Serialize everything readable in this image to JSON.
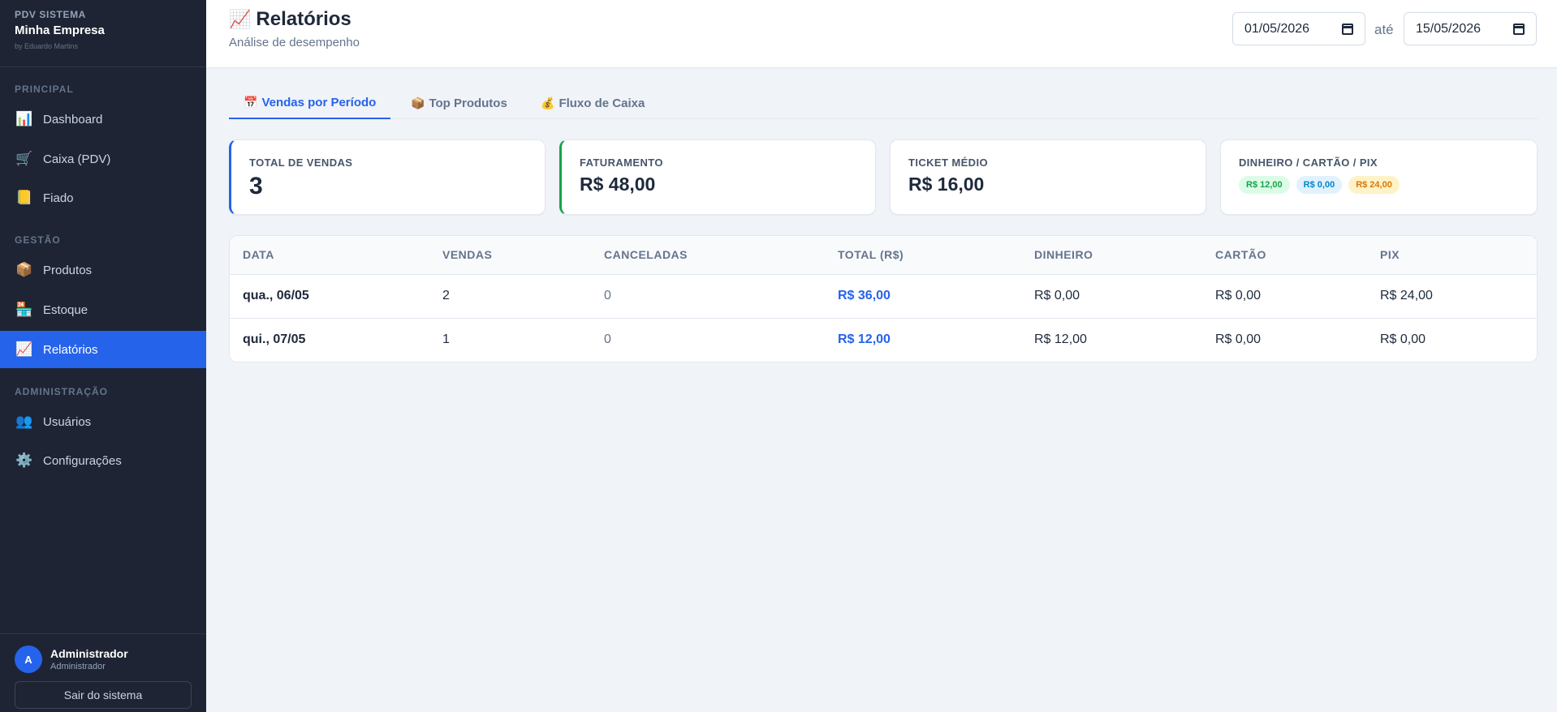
{
  "brand": {
    "kicker": "PDV SISTEMA",
    "name": "Minha Empresa",
    "by": "by Eduardo Martins"
  },
  "sidebar": {
    "sections": [
      {
        "label": "PRINCIPAL"
      },
      {
        "label": "GESTÃO"
      },
      {
        "label": "ADMINISTRAÇÃO"
      }
    ],
    "items": [
      {
        "label": "Dashboard",
        "icon": "bar-chart-icon",
        "glyph": "📊"
      },
      {
        "label": "Caixa (PDV)",
        "icon": "cart-icon",
        "glyph": "🛒"
      },
      {
        "label": "Fiado",
        "icon": "ledger-icon",
        "glyph": "📒"
      },
      {
        "label": "Produtos",
        "icon": "package-icon",
        "glyph": "📦"
      },
      {
        "label": "Estoque",
        "icon": "store-icon",
        "glyph": "🏪"
      },
      {
        "label": "Relatórios",
        "icon": "chart-up-icon",
        "glyph": "📈",
        "active": true
      },
      {
        "label": "Usuários",
        "icon": "users-icon",
        "glyph": "👥"
      },
      {
        "label": "Configurações",
        "icon": "gear-icon",
        "glyph": "⚙️"
      }
    ]
  },
  "user": {
    "initial": "A",
    "name": "Administrador",
    "role": "Administrador",
    "logout_label": "Sair do sistema"
  },
  "header": {
    "title_glyph": "📈",
    "title": "Relatórios",
    "subtitle": "Análise de desempenho",
    "date_from": "01/05/2026",
    "date_sep": "até",
    "date_to": "15/05/2026"
  },
  "tabs": [
    {
      "glyph": "📅",
      "label": "Vendas por Período",
      "active": true
    },
    {
      "glyph": "📦",
      "label": "Top Produtos"
    },
    {
      "glyph": "💰",
      "label": "Fluxo de Caixa"
    }
  ],
  "cards": {
    "total_vendas": {
      "label": "TOTAL DE VENDAS",
      "value": "3"
    },
    "faturamento": {
      "label": "FATURAMENTO",
      "value": "R$ 48,00"
    },
    "ticket": {
      "label": "TICKET MÉDIO",
      "value": "R$ 16,00"
    },
    "metodos": {
      "label": "DINHEIRO / CARTÃO / PIX",
      "dinheiro": "R$ 12,00",
      "cartao": "R$ 0,00",
      "pix": "R$ 24,00"
    }
  },
  "colors": {
    "accent": "#2563eb",
    "sidebar_bg": "#1e2433",
    "green": "#16a34a",
    "blue": "#0284c7",
    "orange": "#d97706"
  },
  "table": {
    "headers": [
      "DATA",
      "VENDAS",
      "CANCELADAS",
      "TOTAL (R$)",
      "DINHEIRO",
      "CARTÃO",
      "PIX"
    ],
    "rows": [
      [
        "qua., 06/05",
        "2",
        "0",
        "R$ 36,00",
        "R$ 0,00",
        "R$ 0,00",
        "R$ 24,00"
      ],
      [
        "qui., 07/05",
        "1",
        "0",
        "R$ 12,00",
        "R$ 12,00",
        "R$ 0,00",
        "R$ 0,00"
      ]
    ]
  }
}
